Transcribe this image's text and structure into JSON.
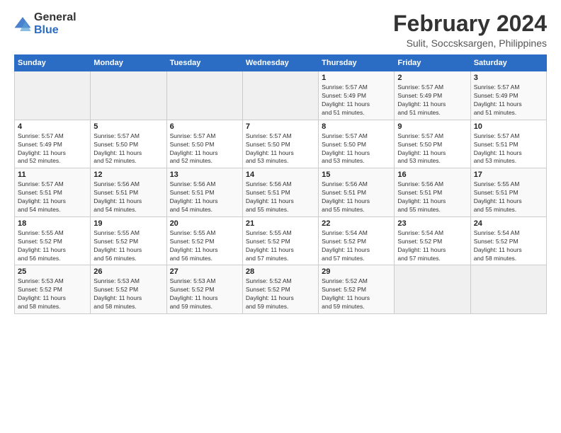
{
  "logo": {
    "general": "General",
    "blue": "Blue"
  },
  "title": "February 2024",
  "subtitle": "Sulit, Soccsksargen, Philippines",
  "days_of_week": [
    "Sunday",
    "Monday",
    "Tuesday",
    "Wednesday",
    "Thursday",
    "Friday",
    "Saturday"
  ],
  "weeks": [
    [
      {
        "day": "",
        "info": ""
      },
      {
        "day": "",
        "info": ""
      },
      {
        "day": "",
        "info": ""
      },
      {
        "day": "",
        "info": ""
      },
      {
        "day": "1",
        "info": "Sunrise: 5:57 AM\nSunset: 5:49 PM\nDaylight: 11 hours\nand 51 minutes."
      },
      {
        "day": "2",
        "info": "Sunrise: 5:57 AM\nSunset: 5:49 PM\nDaylight: 11 hours\nand 51 minutes."
      },
      {
        "day": "3",
        "info": "Sunrise: 5:57 AM\nSunset: 5:49 PM\nDaylight: 11 hours\nand 51 minutes."
      }
    ],
    [
      {
        "day": "4",
        "info": "Sunrise: 5:57 AM\nSunset: 5:49 PM\nDaylight: 11 hours\nand 52 minutes."
      },
      {
        "day": "5",
        "info": "Sunrise: 5:57 AM\nSunset: 5:50 PM\nDaylight: 11 hours\nand 52 minutes."
      },
      {
        "day": "6",
        "info": "Sunrise: 5:57 AM\nSunset: 5:50 PM\nDaylight: 11 hours\nand 52 minutes."
      },
      {
        "day": "7",
        "info": "Sunrise: 5:57 AM\nSunset: 5:50 PM\nDaylight: 11 hours\nand 53 minutes."
      },
      {
        "day": "8",
        "info": "Sunrise: 5:57 AM\nSunset: 5:50 PM\nDaylight: 11 hours\nand 53 minutes."
      },
      {
        "day": "9",
        "info": "Sunrise: 5:57 AM\nSunset: 5:50 PM\nDaylight: 11 hours\nand 53 minutes."
      },
      {
        "day": "10",
        "info": "Sunrise: 5:57 AM\nSunset: 5:51 PM\nDaylight: 11 hours\nand 53 minutes."
      }
    ],
    [
      {
        "day": "11",
        "info": "Sunrise: 5:57 AM\nSunset: 5:51 PM\nDaylight: 11 hours\nand 54 minutes."
      },
      {
        "day": "12",
        "info": "Sunrise: 5:56 AM\nSunset: 5:51 PM\nDaylight: 11 hours\nand 54 minutes."
      },
      {
        "day": "13",
        "info": "Sunrise: 5:56 AM\nSunset: 5:51 PM\nDaylight: 11 hours\nand 54 minutes."
      },
      {
        "day": "14",
        "info": "Sunrise: 5:56 AM\nSunset: 5:51 PM\nDaylight: 11 hours\nand 55 minutes."
      },
      {
        "day": "15",
        "info": "Sunrise: 5:56 AM\nSunset: 5:51 PM\nDaylight: 11 hours\nand 55 minutes."
      },
      {
        "day": "16",
        "info": "Sunrise: 5:56 AM\nSunset: 5:51 PM\nDaylight: 11 hours\nand 55 minutes."
      },
      {
        "day": "17",
        "info": "Sunrise: 5:55 AM\nSunset: 5:51 PM\nDaylight: 11 hours\nand 55 minutes."
      }
    ],
    [
      {
        "day": "18",
        "info": "Sunrise: 5:55 AM\nSunset: 5:52 PM\nDaylight: 11 hours\nand 56 minutes."
      },
      {
        "day": "19",
        "info": "Sunrise: 5:55 AM\nSunset: 5:52 PM\nDaylight: 11 hours\nand 56 minutes."
      },
      {
        "day": "20",
        "info": "Sunrise: 5:55 AM\nSunset: 5:52 PM\nDaylight: 11 hours\nand 56 minutes."
      },
      {
        "day": "21",
        "info": "Sunrise: 5:55 AM\nSunset: 5:52 PM\nDaylight: 11 hours\nand 57 minutes."
      },
      {
        "day": "22",
        "info": "Sunrise: 5:54 AM\nSunset: 5:52 PM\nDaylight: 11 hours\nand 57 minutes."
      },
      {
        "day": "23",
        "info": "Sunrise: 5:54 AM\nSunset: 5:52 PM\nDaylight: 11 hours\nand 57 minutes."
      },
      {
        "day": "24",
        "info": "Sunrise: 5:54 AM\nSunset: 5:52 PM\nDaylight: 11 hours\nand 58 minutes."
      }
    ],
    [
      {
        "day": "25",
        "info": "Sunrise: 5:53 AM\nSunset: 5:52 PM\nDaylight: 11 hours\nand 58 minutes."
      },
      {
        "day": "26",
        "info": "Sunrise: 5:53 AM\nSunset: 5:52 PM\nDaylight: 11 hours\nand 58 minutes."
      },
      {
        "day": "27",
        "info": "Sunrise: 5:53 AM\nSunset: 5:52 PM\nDaylight: 11 hours\nand 59 minutes."
      },
      {
        "day": "28",
        "info": "Sunrise: 5:52 AM\nSunset: 5:52 PM\nDaylight: 11 hours\nand 59 minutes."
      },
      {
        "day": "29",
        "info": "Sunrise: 5:52 AM\nSunset: 5:52 PM\nDaylight: 11 hours\nand 59 minutes."
      },
      {
        "day": "",
        "info": ""
      },
      {
        "day": "",
        "info": ""
      }
    ]
  ]
}
